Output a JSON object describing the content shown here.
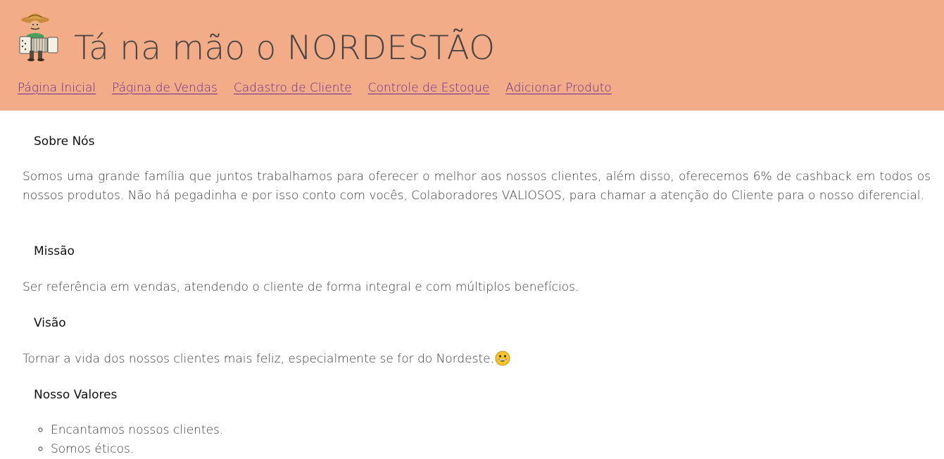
{
  "header": {
    "title": "Tá na mão o NORDESTÃO",
    "logo_icon": "accordion-player-icon",
    "background_color": "#f2ad88",
    "nav": [
      {
        "label": "Página Inicial"
      },
      {
        "label": "Página de Vendas"
      },
      {
        "label": "Cadastro de Cliente"
      },
      {
        "label": "Controle de Estoque"
      },
      {
        "label": "Adicionar Produto"
      }
    ],
    "link_color": "#6a2c8f"
  },
  "main": {
    "about": {
      "heading": "Sobre Nós",
      "text": "Somos uma grande família que juntos trabalhamos para oferecer o melhor aos nossos clientes, além disso, oferecemos 6% de cashback em todos os nossos produtos. Não há pegadinha e por isso conto com vocês, Colaboradores VALIOSOS, para chamar a atenção do Cliente para o nosso diferencial."
    },
    "mission": {
      "heading": "Missão",
      "text": "Ser referência em vendas, atendendo o cliente de forma integral e com múltiplos benefícios."
    },
    "vision": {
      "heading": "Visão",
      "text": "Tornar a vida dos nossos clientes mais feliz, especialmente se for do Nordeste.",
      "emoji_icon": "grinning-face-icon"
    },
    "values": {
      "heading": "Nosso Valores",
      "items": [
        "Encantamos nossos clientes.",
        "Somos éticos."
      ]
    }
  }
}
